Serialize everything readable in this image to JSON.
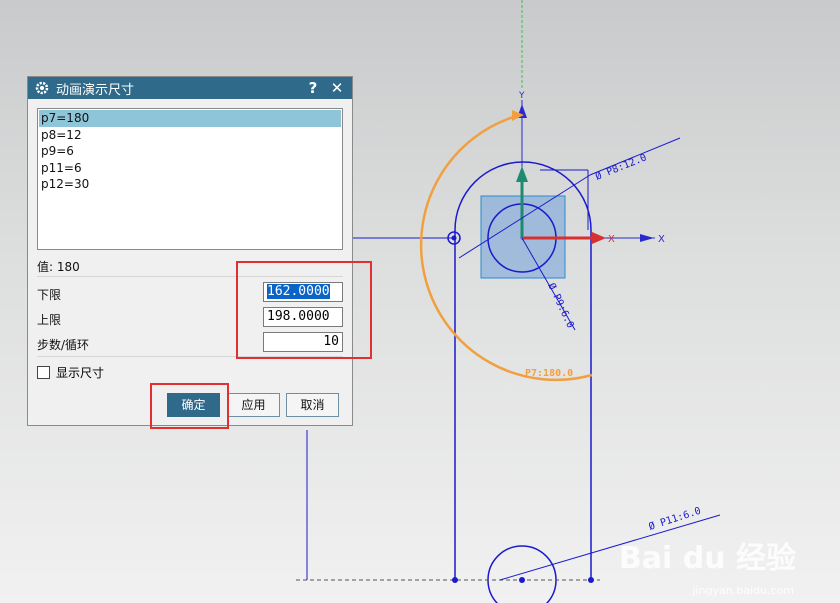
{
  "dialog": {
    "title": "动画演示尺寸",
    "help_label": "?",
    "close_label": "✕",
    "list": [
      {
        "label": "p7=180",
        "selected": true
      },
      {
        "label": "p8=12",
        "selected": false
      },
      {
        "label": "p9=6",
        "selected": false
      },
      {
        "label": "p11=6",
        "selected": false
      },
      {
        "label": "p12=30",
        "selected": false
      }
    ],
    "value_label": "值:  180",
    "lower_label": "下限",
    "lower_value": "162.0000",
    "upper_label": "上限",
    "upper_value": "198.0000",
    "steps_label": "步数/循环",
    "steps_value": "10",
    "show_dims_label": "显示尺寸",
    "ok_label": "确定",
    "apply_label": "应用",
    "cancel_label": "取消"
  },
  "sketch": {
    "axis_y_label": "Y",
    "axis_x_label": "X",
    "dim_p8": "Ø P8:12.0",
    "dim_p9": "Ø P9:6.0",
    "dim_p7": "P7:180.0",
    "dim_p11": "Ø P11:6.0"
  },
  "watermark": {
    "logo": "Bai du 经验",
    "url": "jingyan.baidu.com"
  },
  "colors": {
    "accent": "#2f6a8a",
    "sketch_blue": "#1a1acc",
    "dimension_orange": "#f0a040",
    "highlight_red": "#e03030"
  }
}
